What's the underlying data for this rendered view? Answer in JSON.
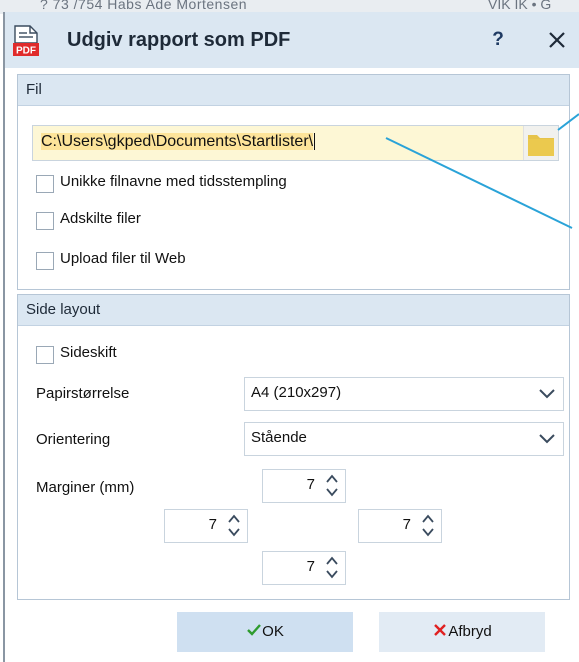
{
  "background": {
    "strip_text": "? 73 /754 Habs Ade Mortensen",
    "strip_text_right": "VIK IK • G"
  },
  "dialog": {
    "title": "Udgiv rapport som PDF",
    "help_label": "?",
    "icon": "pdf-document-icon",
    "close_icon": "close-icon"
  },
  "fil_group": {
    "header": "Fil",
    "path_value": "C:\\Users\\gkped\\Documents\\Startlister\\",
    "folder_icon": "folder-icon",
    "checkboxes": [
      {
        "label": "Unikke filnavne med tidsstempling",
        "checked": false
      },
      {
        "label": "Adskilte filer",
        "checked": false
      },
      {
        "label": "Upload filer til Web",
        "checked": false
      }
    ]
  },
  "layout_group": {
    "header": "Side layout",
    "sideskift": {
      "label": "Sideskift",
      "checked": false
    },
    "paper": {
      "label": "Papirstørrelse",
      "value": "A4 (210x297)"
    },
    "orientation": {
      "label": "Orientering",
      "value": "Stående"
    },
    "margins": {
      "label": "Marginer (mm)",
      "top": "7",
      "left": "7",
      "right": "7",
      "bottom": "7"
    }
  },
  "buttons": {
    "ok": "OK",
    "cancel": "Afbryd"
  },
  "colors": {
    "titlebar": "#dbe7f2",
    "ok_check": "#2e9b2e",
    "cancel_x": "#e02020",
    "callout_line": "#2aa3d8",
    "folder": "#e6c34a"
  }
}
